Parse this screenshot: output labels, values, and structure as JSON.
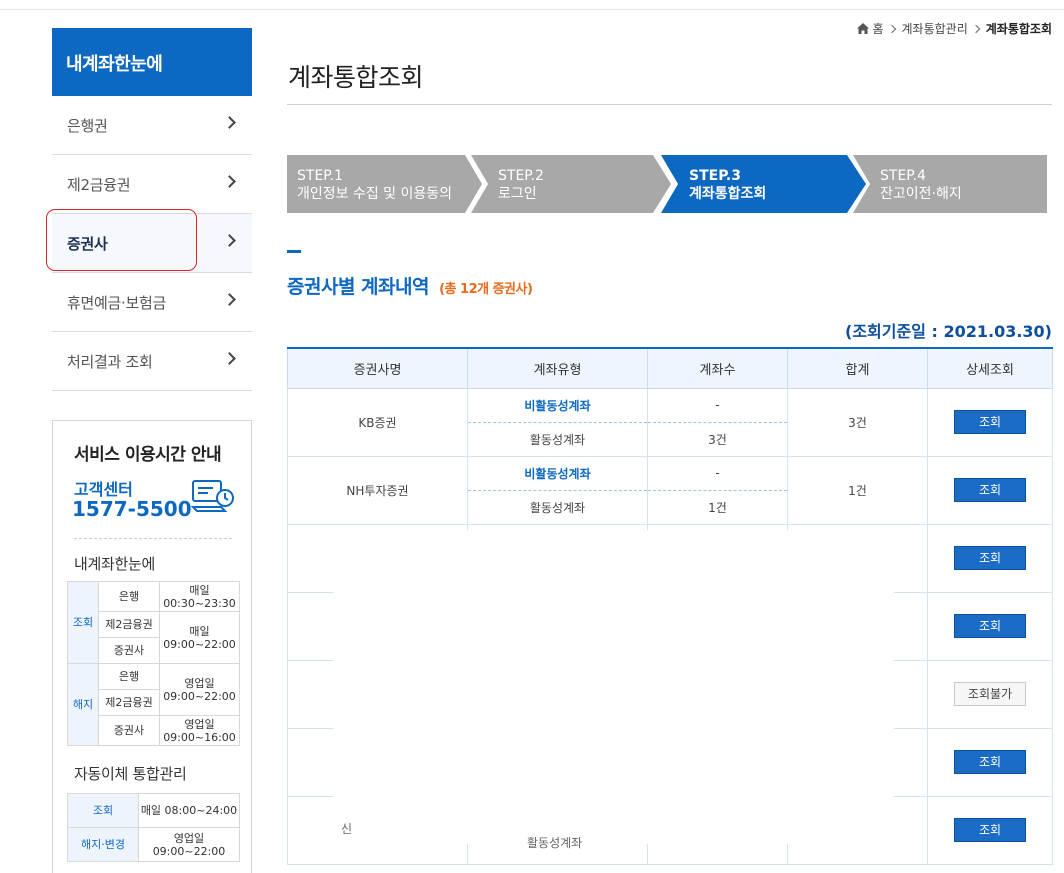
{
  "breadcrumb": {
    "home": "홈",
    "level1": "계좌통합관리",
    "current": "계좌통합조회"
  },
  "sidebar": {
    "header": "내계좌한눈에",
    "items": [
      {
        "label": "은행권"
      },
      {
        "label": "제2금융권"
      },
      {
        "label": "증권사"
      },
      {
        "label": "휴면예금·보험금"
      },
      {
        "label": "처리결과 조회"
      }
    ],
    "active_index": 2,
    "service": {
      "title": "서비스 이용시간 안내",
      "center_label": "고객센터",
      "phone": "1577-5500",
      "section1_title": "내계좌한눈에",
      "table1": {
        "cat_lookup": "조회",
        "cat_cancel": "해지",
        "rows": [
          {
            "name": "은행",
            "time": "매일 00:30~23:30"
          },
          {
            "name": "제2금융권",
            "time": "매일 09:00~22:00"
          },
          {
            "name": "증권사",
            "time": ""
          },
          {
            "name": "은행",
            "time": "영업일 09:00~22:00"
          },
          {
            "name": "제2금융권",
            "time": ""
          },
          {
            "name": "증권사",
            "time": "영업일 09:00~16:00"
          }
        ]
      },
      "section2_title": "자동이체 통합관리",
      "table2": [
        {
          "cat": "조회",
          "time": "매일 08:00~24:00"
        },
        {
          "cat": "해지·변경",
          "time": "영업일 09:00~22:00"
        }
      ]
    }
  },
  "page": {
    "title": "계좌통합조회",
    "steps": [
      {
        "num": "STEP.1",
        "label": "개인정보 수집 및 이용동의"
      },
      {
        "num": "STEP.2",
        "label": "로그인"
      },
      {
        "num": "STEP.3",
        "label": "계좌통합조회"
      },
      {
        "num": "STEP.4",
        "label": "잔고이전·해지"
      }
    ],
    "active_step": 2,
    "section_title": "증권사별 계좌내역",
    "section_count": "(총 12개 증권사)",
    "basis_date": "(조회기준일 : 2021.03.30)"
  },
  "table": {
    "headers": [
      "증권사명",
      "계좌유형",
      "계좌수",
      "합계",
      "상세조회"
    ],
    "type_inactive": "비활동성계좌",
    "type_active": "활동성계좌",
    "btn_lookup": "조회",
    "btn_unavailable": "조회불가",
    "rows": [
      {
        "name": "KB증권",
        "inactive_count": "-",
        "active_count": "3건",
        "total": "3건"
      },
      {
        "name": "NH투자증권",
        "inactive_count": "-",
        "active_count": "1건",
        "total": "1건"
      }
    ],
    "partial_name": "신",
    "partial_type": "활동성계좌"
  },
  "colors": {
    "accent": "#0d68c2",
    "step_inactive": "#a8a8a8",
    "count_orange": "#e66a1a"
  }
}
